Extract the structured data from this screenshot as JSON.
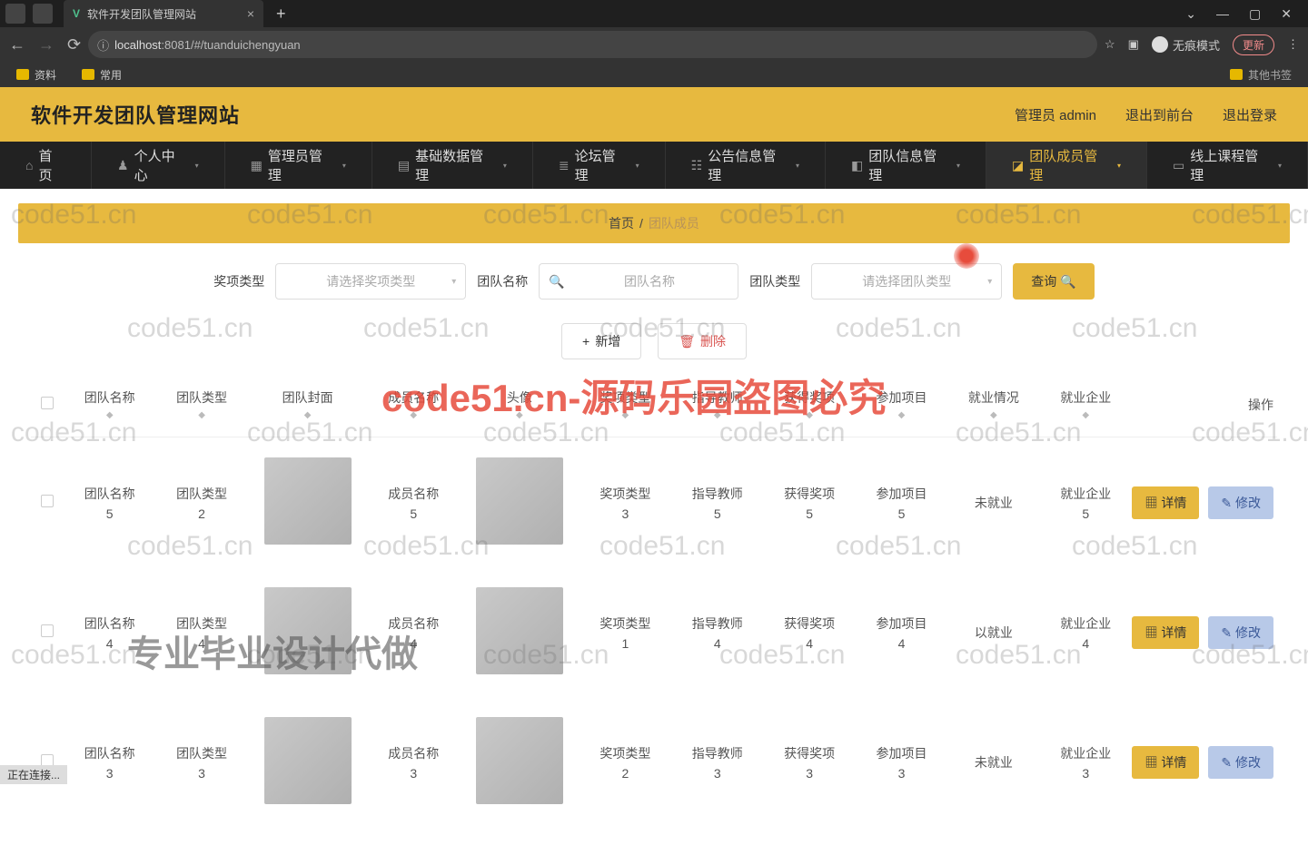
{
  "browser": {
    "tab_title": "软件开发团队管理网站",
    "url_host": "localhost",
    "url_path": ":8081/#/tuanduichengyuan",
    "incognito": "无痕模式",
    "update": "更新",
    "bookmarks": {
      "b1": "资料",
      "b2": "常用",
      "other": "其他书签"
    }
  },
  "site": {
    "title": "软件开发团队管理网站",
    "user": "管理员 admin",
    "back_front": "退出到前台",
    "logout": "退出登录"
  },
  "nav": {
    "i0": "首页",
    "i1": "个人中心",
    "i2": "管理员管理",
    "i3": "基础数据管理",
    "i4": "论坛管理",
    "i5": "公告信息管理",
    "i6": "团队信息管理",
    "i7": "团队成员管理",
    "i8": "线上课程管理"
  },
  "breadcrumb": {
    "home": "首页",
    "sep": "/",
    "current": "团队成员"
  },
  "filter": {
    "l1": "奖项类型",
    "p1": "请选择奖项类型",
    "l2": "团队名称",
    "p2": "团队名称",
    "l3": "团队类型",
    "p3": "请选择团队类型",
    "query": "查询"
  },
  "actions": {
    "add": "新增",
    "del": "删除"
  },
  "head": {
    "c1": "团队名称",
    "c2": "团队类型",
    "c3": "团队封面",
    "c4": "成员名称",
    "c5": "头像",
    "c6": "奖项类型",
    "c7": "指导教师",
    "c8": "获得奖项",
    "c9": "参加项目",
    "c10": "就业情况",
    "c11": "就业企业",
    "c12": "操作"
  },
  "rows": [
    {
      "tname": "团队名称",
      "tnameN": "5",
      "ttype": "团队类型",
      "ttypeN": "2",
      "mname": "成员名称",
      "mnameN": "5",
      "award": "奖项类型",
      "awardN": "3",
      "teacher": "指导教师",
      "teacherN": "5",
      "got": "获得奖项",
      "gotN": "5",
      "proj": "参加项目",
      "projN": "5",
      "job": "未就业",
      "co": "就业企业",
      "coN": "5"
    },
    {
      "tname": "团队名称",
      "tnameN": "4",
      "ttype": "团队类型",
      "ttypeN": "4",
      "mname": "成员名称",
      "mnameN": "4",
      "award": "奖项类型",
      "awardN": "1",
      "teacher": "指导教师",
      "teacherN": "4",
      "got": "获得奖项",
      "gotN": "4",
      "proj": "参加项目",
      "projN": "4",
      "job": "以就业",
      "co": "就业企业",
      "coN": "4"
    },
    {
      "tname": "团队名称",
      "tnameN": "3",
      "ttype": "团队类型",
      "ttypeN": "3",
      "mname": "成员名称",
      "mnameN": "3",
      "award": "奖项类型",
      "awardN": "2",
      "teacher": "指导教师",
      "teacherN": "3",
      "got": "获得奖项",
      "gotN": "3",
      "proj": "参加项目",
      "projN": "3",
      "job": "未就业",
      "co": "就业企业",
      "coN": "3"
    }
  ],
  "ops": {
    "detail": "详情",
    "edit": "修改"
  },
  "wm": {
    "w1": "code51.cn",
    "big": "code51.cn-源码乐园盗图必究",
    "big2": "专业毕业设计代做"
  },
  "statusbar": "正在连接..."
}
